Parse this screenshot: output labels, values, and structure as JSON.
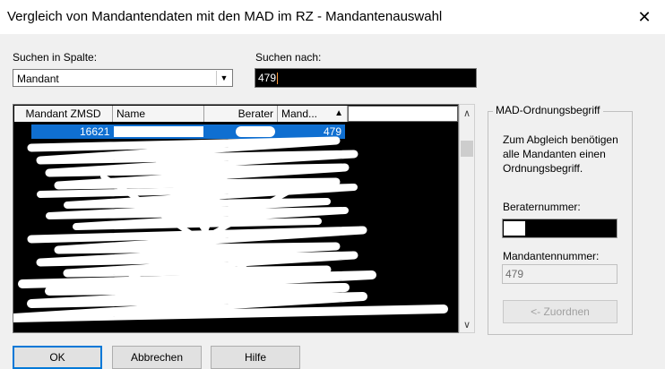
{
  "window": {
    "title": "Vergleich von Mandantendaten mit den MAD im RZ - Mandantenauswahl",
    "close_glyph": "✕"
  },
  "search_column": {
    "label": "Suchen in Spalte:",
    "value": "Mandant",
    "arrow_glyph": "▼"
  },
  "search_for": {
    "label": "Suchen nach:",
    "value": "479"
  },
  "table": {
    "headers": [
      "Mandant ZMSD",
      "Name",
      "Berater",
      "Mand..."
    ],
    "sort_glyph": "▲",
    "selected_row": {
      "zmsd": "16621",
      "mandant": "479"
    }
  },
  "scrollbar": {
    "up_glyph": "∧",
    "down_glyph": "∨"
  },
  "mad_group": {
    "legend": "MAD-Ordnungsbegriff",
    "description": "Zum Abgleich benötigen alle Mandanten einen Ordnungsbegriff.",
    "berater_label": "Beraternummer:",
    "mandant_label": "Mandantennummer:",
    "mandant_value": "479",
    "assign_button": "<- Zuordnen"
  },
  "buttons": {
    "ok": "OK",
    "cancel": "Abbrechen",
    "help": "Hilfe"
  }
}
